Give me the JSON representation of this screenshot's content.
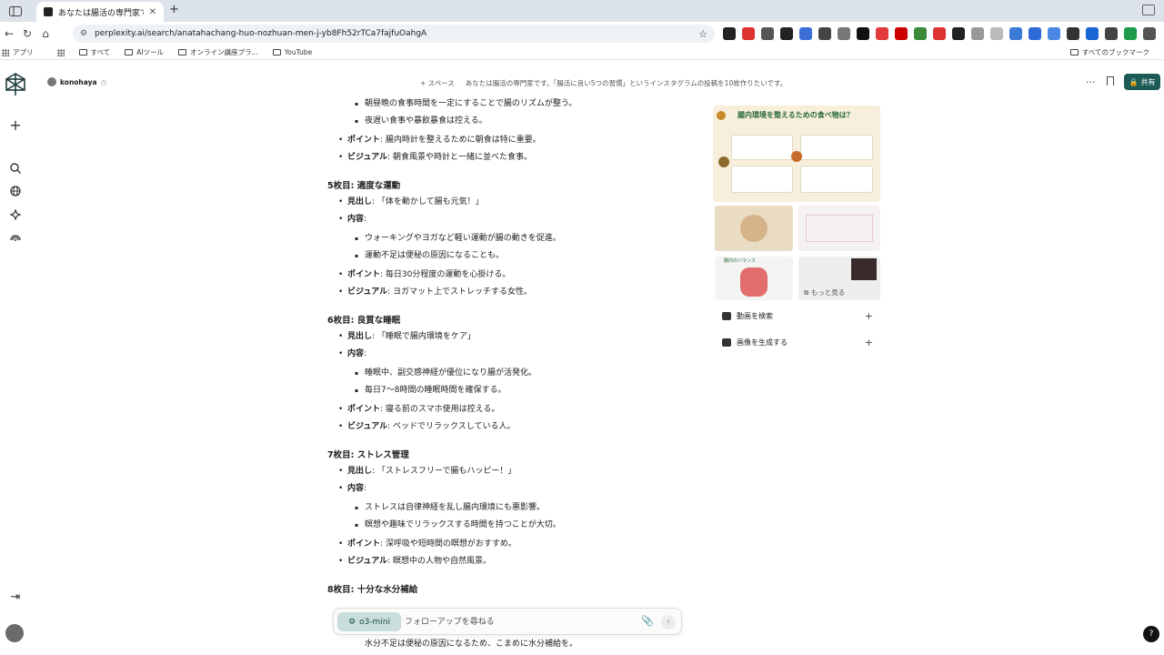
{
  "browser": {
    "tab_title": "あなたは腸活の専門家です。「腸",
    "url": "perplexity.ai/search/anatahachang-huo-nozhuan-men-j-yb8Fh52rTCa7fajfuOahgA",
    "bookmarks": [
      "アプリ",
      "すべて",
      "AIツール",
      "オンライン講座プラ...",
      "YouTube"
    ],
    "bookmarks_right": "すべてのブックマーク"
  },
  "header": {
    "user": "konohaya",
    "space_label": "+ スペース",
    "thread_title": "あなたは腸活の専門家です。「腸活に良い5つの習慣」というインスタグラムの投稿を10枚作りたいです。",
    "share_label": "共有"
  },
  "content": {
    "top": [
      {
        "level": 2,
        "text": "朝昼晩の食事時間を一定にすることで腸のリズムが整う。"
      },
      {
        "level": 2,
        "text": "夜遅い食事や暴飲暴食は控える。"
      },
      {
        "level": 1,
        "label": "ポイント",
        "text": ": 腸内時計を整えるために朝食は特に重要。"
      },
      {
        "level": 1,
        "label": "ビジュアル",
        "text": ": 朝食風景や時計と一緒に並べた食事。"
      }
    ],
    "s5_title": "5枚目: 適度な運動",
    "s5": [
      {
        "level": 1,
        "label": "見出し",
        "text": ": 「体を動かして腸も元気！」"
      },
      {
        "level": 1,
        "label": "内容",
        "text": ":"
      },
      {
        "level": 2,
        "text": "ウォーキングやヨガなど軽い運動が腸の動きを促進。"
      },
      {
        "level": 2,
        "text": "運動不足は便秘の原因になることも。"
      },
      {
        "level": 1,
        "label": "ポイント",
        "text": ": 毎日30分程度の運動を心掛ける。"
      },
      {
        "level": 1,
        "label": "ビジュアル",
        "text": ": ヨガマット上でストレッチする女性。"
      }
    ],
    "s6_title": "6枚目: 良質な睡眠",
    "s6": [
      {
        "level": 1,
        "label": "見出し",
        "text": ": 「睡眠で腸内環境をケア」"
      },
      {
        "level": 1,
        "label": "内容",
        "text": ":"
      },
      {
        "level": 2,
        "text": "睡眠中、副交感神経が優位になり腸が活発化。"
      },
      {
        "level": 2,
        "text": "毎日7〜8時間の睡眠時間を確保する。"
      },
      {
        "level": 1,
        "label": "ポイント",
        "text": ": 寝る前のスマホ使用は控える。"
      },
      {
        "level": 1,
        "label": "ビジュアル",
        "text": ": ベッドでリラックスしている人。"
      }
    ],
    "s7_title": "7枚目: ストレス管理",
    "s7": [
      {
        "level": 1,
        "label": "見出し",
        "text": ": 「ストレスフリーで腸もハッピー！」"
      },
      {
        "level": 1,
        "label": "内容",
        "text": ":"
      },
      {
        "level": 2,
        "text": "ストレスは自律神経を乱し腸内環境にも悪影響。"
      },
      {
        "level": 2,
        "text": "瞑想や趣味でリラックスする時間を持つことが大切。"
      },
      {
        "level": 1,
        "label": "ポイント",
        "text": ": 深呼吸や短時間の瞑想がおすすめ。"
      },
      {
        "level": 1,
        "label": "ビジュアル",
        "text": ": 瞑想中の人物や自然風景。"
      }
    ],
    "s8_title": "8枚目: 十分な水分補給",
    "cutoff": "水分不足は便秘の原因になるため、こまめに水分補給を。"
  },
  "sidebar": {
    "media_title": "腸内環境を整えるための食べ物は？",
    "thumb_a": "腸内のバランス",
    "more_label": "もっと見る",
    "video_search": "動画を検索",
    "generate_image": "画像を生成する"
  },
  "ask": {
    "model": "o3-mini",
    "placeholder": "フォローアップを尋ねる"
  },
  "colors": {
    "accent": "#1d5b56",
    "chip": "#c9dedc"
  }
}
